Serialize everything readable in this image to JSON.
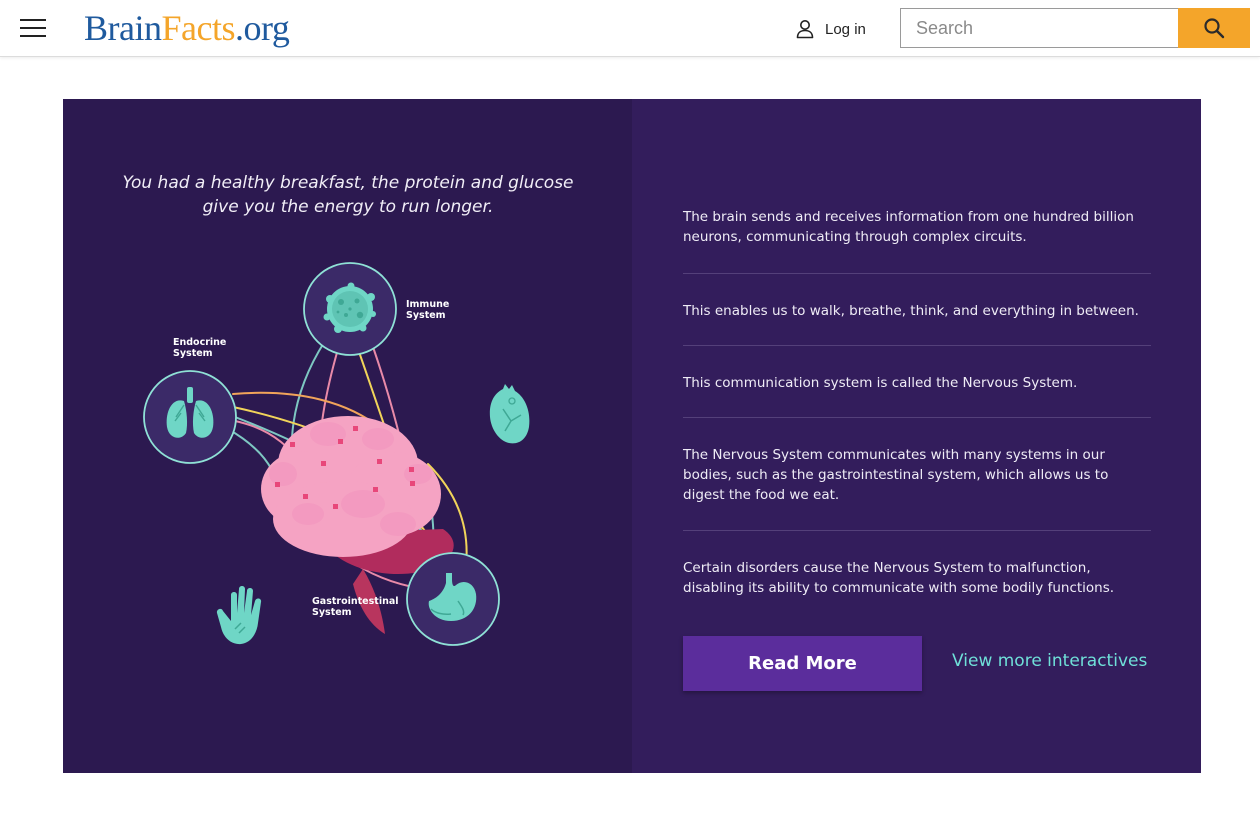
{
  "header": {
    "logo": {
      "brain": "Brain",
      "facts": "Facts",
      "org": ".org"
    },
    "login_label": "Log in",
    "search_placeholder": "Search"
  },
  "colors": {
    "accent": "#f4a52a",
    "brand_blue": "#1f5a9e",
    "panel_bg": "#2e1a54",
    "button_purple": "#5b2d9c",
    "link_teal": "#6fe0d8"
  },
  "interactive": {
    "quote": "You had a healthy breakfast, the protein and glucose give you the energy to run longer.",
    "systems": {
      "immune": [
        "Immune",
        "System"
      ],
      "endocrine": [
        "Endocrine",
        "System"
      ],
      "gastro": [
        "Gastrointestinal",
        "System"
      ]
    },
    "icons": [
      "virus-icon",
      "lungs-icon",
      "heart-icon",
      "hand-icon",
      "stomach-icon",
      "brain-illustration"
    ]
  },
  "info": {
    "items": [
      "The brain sends and receives information from one hundred billion neurons, communicating through complex circuits.",
      "This enables us to walk, breathe, think, and everything in between.",
      "This communication system is called the Nervous System.",
      "The Nervous System communicates with many systems in our bodies, such as the gastrointestinal system, which allows us to digest the food we eat.",
      "Certain disorders cause the Nervous System to malfunction, disabling its ability to communicate with some bodily functions."
    ],
    "read_more": "Read More",
    "view_more": "View more interactives"
  }
}
